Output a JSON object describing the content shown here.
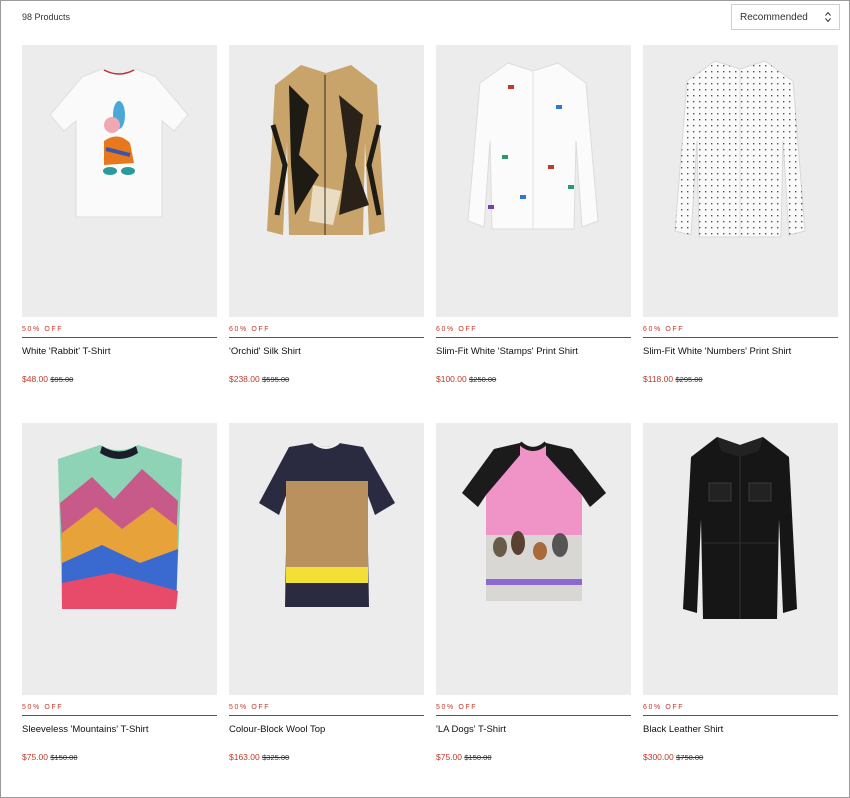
{
  "listing": {
    "count_label": "98 Products",
    "sort": {
      "selected": "Recommended"
    }
  },
  "products": [
    {
      "badge": "50% OFF",
      "name": "White 'Rabbit' T-Shirt",
      "price": "$48.00",
      "was": "$95.00"
    },
    {
      "badge": "60% OFF",
      "name": "'Orchid' Silk Shirt",
      "price": "$238.00",
      "was": "$595.00"
    },
    {
      "badge": "60% OFF",
      "name": "Slim-Fit White 'Stamps' Print Shirt",
      "price": "$100.00",
      "was": "$250.00"
    },
    {
      "badge": "60% OFF",
      "name": "Slim-Fit White 'Numbers' Print Shirt",
      "price": "$118.00",
      "was": "$295.00"
    },
    {
      "badge": "50% OFF",
      "name": "Sleeveless 'Mountains' T-Shirt",
      "price": "$75.00",
      "was": "$150.00"
    },
    {
      "badge": "50% OFF",
      "name": "Colour-Block Wool Top",
      "price": "$163.00",
      "was": "$325.00"
    },
    {
      "badge": "50% OFF",
      "name": "'LA Dogs' T-Shirt",
      "price": "$75.00",
      "was": "$150.00"
    },
    {
      "badge": "60% OFF",
      "name": "Black Leather Shirt",
      "price": "$300.00",
      "was": "$750.00"
    }
  ],
  "colors": {
    "sale": "#c0392b",
    "image_bg": "#ececec"
  }
}
